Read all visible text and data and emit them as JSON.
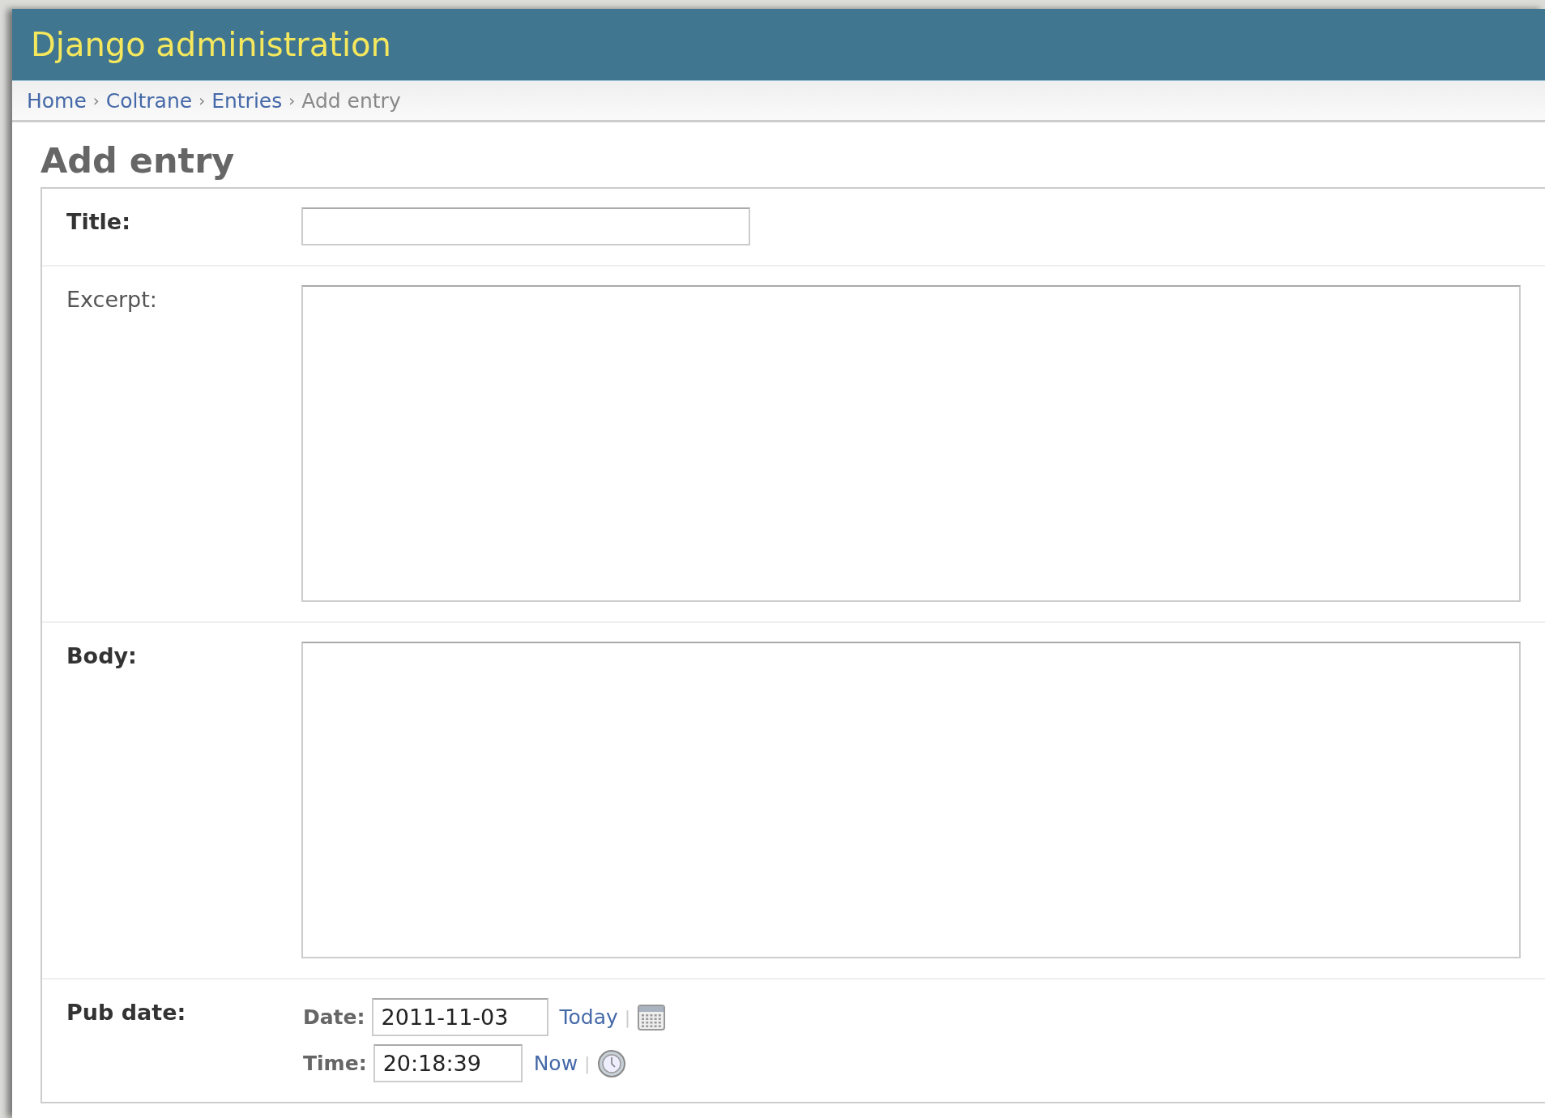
{
  "header": {
    "title": "Django administration"
  },
  "breadcrumbs": [
    {
      "label": "Home",
      "link": true
    },
    {
      "label": "Coltrane",
      "link": true
    },
    {
      "label": "Entries",
      "link": true
    },
    {
      "label": "Add entry",
      "link": false
    }
  ],
  "breadcrumb_separator": "›",
  "heading": "Add entry",
  "fields": [
    {
      "kind": "text",
      "label": "Title:",
      "required": true
    },
    {
      "kind": "textarea",
      "label": "Excerpt:",
      "required": false
    },
    {
      "kind": "textarea",
      "label": "Body:",
      "required": true
    },
    {
      "kind": "datetime",
      "label": "Pub date:",
      "required": true,
      "date": {
        "label": "Date:",
        "value": "2011-11-03",
        "shortcut": "Today"
      },
      "time": {
        "label": "Time:",
        "value": "20:18:39",
        "shortcut": "Now"
      },
      "separator": "|"
    }
  ]
}
